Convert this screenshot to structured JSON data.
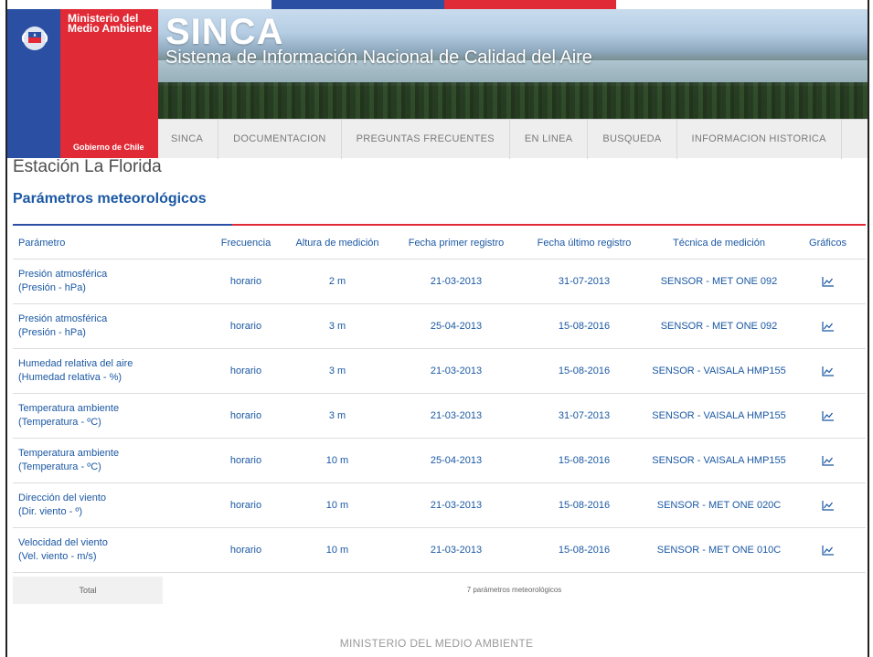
{
  "header": {
    "ministry": "Ministerio del Medio Ambiente",
    "gov_label": "Gobierno de Chile",
    "brand": "SINCA",
    "subtitle": "Sistema de Información Nacional de Calidad del Aire",
    "colors": {
      "blue": "#2a4fa3",
      "red": "#e02b36"
    }
  },
  "nav": {
    "items": [
      {
        "label": "SINCA"
      },
      {
        "label": "DOCUMENTACION"
      },
      {
        "label": "PREGUNTAS FRECUENTES"
      },
      {
        "label": "EN LINEA"
      },
      {
        "label": "BUSQUEDA"
      },
      {
        "label": "INFORMACION HISTORICA"
      }
    ]
  },
  "page": {
    "station_title": "Estación La Florida",
    "section_title": "Parámetros meteorológicos"
  },
  "table": {
    "columns": [
      "Parámetro",
      "Frecuencia",
      "Altura de medición",
      "Fecha primer registro",
      "Fecha último registro",
      "Técnica de medición",
      "Gráficos"
    ],
    "rows": [
      {
        "name": "Presión atmosférica",
        "unit": "(Presión - hPa)",
        "freq": "horario",
        "height": "2 m",
        "first": "21-03-2013",
        "last": "31-07-2013",
        "technique": "SENSOR - MET ONE 092",
        "chart_icon": "line-chart-icon"
      },
      {
        "name": "Presión atmosférica",
        "unit": "(Presión - hPa)",
        "freq": "horario",
        "height": "3 m",
        "first": "25-04-2013",
        "last": "15-08-2016",
        "technique": "SENSOR - MET ONE 092",
        "chart_icon": "line-chart-icon"
      },
      {
        "name": "Humedad relativa del aire",
        "unit": "(Humedad relativa - %)",
        "freq": "horario",
        "height": "3 m",
        "first": "21-03-2013",
        "last": "15-08-2016",
        "technique": "SENSOR - VAISALA HMP155",
        "chart_icon": "line-chart-icon"
      },
      {
        "name": "Temperatura ambiente",
        "unit": "(Temperatura - ºC)",
        "freq": "horario",
        "height": "3 m",
        "first": "21-03-2013",
        "last": "31-07-2013",
        "technique": "SENSOR - VAISALA HMP155",
        "chart_icon": "line-chart-icon"
      },
      {
        "name": "Temperatura ambiente",
        "unit": "(Temperatura - ºC)",
        "freq": "horario",
        "height": "10 m",
        "first": "25-04-2013",
        "last": "15-08-2016",
        "technique": "SENSOR - VAISALA HMP155",
        "chart_icon": "line-chart-icon"
      },
      {
        "name": "Dirección del viento",
        "unit": "(Dir. viento - º)",
        "freq": "horario",
        "height": "10 m",
        "first": "21-03-2013",
        "last": "15-08-2016",
        "technique": "SENSOR - MET ONE 020C",
        "chart_icon": "line-chart-icon"
      },
      {
        "name": "Velocidad del viento",
        "unit": "(Vel. viento - m/s)",
        "freq": "horario",
        "height": "10 m",
        "first": "21-03-2013",
        "last": "15-08-2016",
        "technique": "SENSOR - MET ONE 010C",
        "chart_icon": "line-chart-icon"
      }
    ],
    "total_label": "Total",
    "total_summary": "7 parámetros meteorológicos"
  },
  "footer": {
    "text": "MINISTERIO DEL MEDIO AMBIENTE"
  }
}
